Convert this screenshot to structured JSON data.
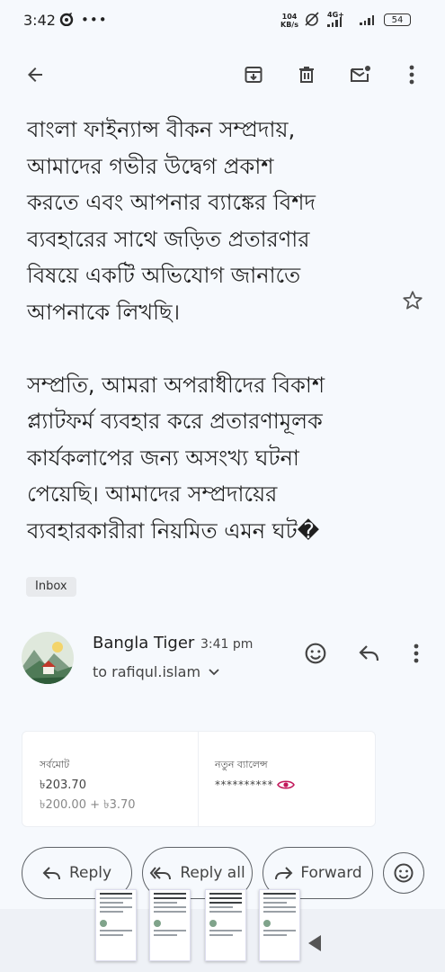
{
  "status_bar": {
    "time": "3:42",
    "net_speed_value": "104",
    "net_speed_unit": "KB/s",
    "network_label": "4G+",
    "battery": "54"
  },
  "toolbar": {
    "icons": [
      "back-arrow-icon",
      "archive-icon",
      "delete-icon",
      "mark-unread-icon",
      "more-vert-icon"
    ]
  },
  "message": {
    "body": "বাংলা ফাইন্যান্স বীকন সম্প্রদায়,\nআমাদের গভীর উদ্বেগ প্রকাশ\nকরতে এবং আপনার ব্যাঙ্কের বিশদ\nব্যবহারের সাথে জড়িত প্রতারণার\nবিষয়ে একটি অভিযোগ জানাতে\nআপনাকে লিখছি।\n\nসম্প্রতি, আমরা অপরাধীদের বিকাশ\nপ্ল্যাটফর্ম ব্যবহার করে প্রতারণামূলক\nকার্যকলাপের জন্য অসংখ্য ঘটনা\nপেয়েছি। আমাদের সম্প্রদায়ের\nব্যবহারকারীরা নিয়মিত এমন ঘট�",
    "label": "Inbox"
  },
  "second_message": {
    "sender": "Bangla Tiger",
    "time": "3:41 pm",
    "recipient": "to rafiqul.islam"
  },
  "receipt_card": {
    "total_label": "সর্বমোট",
    "total_value": "৳203.70",
    "total_breakdown": "৳200.00 + ৳3.70",
    "balance_label": "নতুন ব্যালেন্স",
    "balance_value": "**********"
  },
  "actions": {
    "reply": "Reply",
    "reply_all": "Reply all",
    "forward": "Forward"
  },
  "colors": {
    "background": "#f6f9fd",
    "eye_icon": "#c2185b",
    "text": "#1f1f1f"
  }
}
